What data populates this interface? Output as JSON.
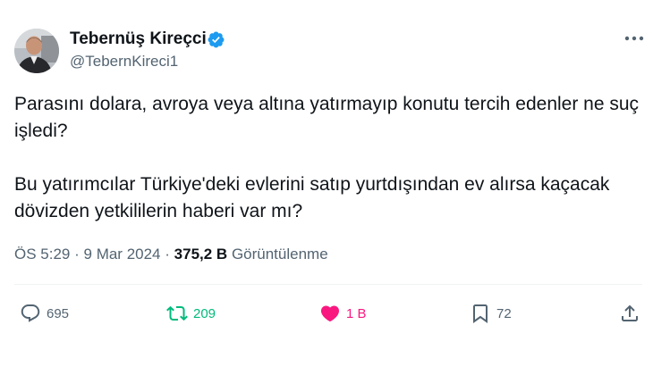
{
  "author": {
    "name": "Tebernüş Kireçci",
    "handle": "@TebernKireci1",
    "verified": true
  },
  "tweet": {
    "paragraphs": [
      "Parasını dolara, avroya veya altına yatırmayıp konutu tercih edenler ne suç işledi?",
      "Bu yatırımcılar Türkiye'deki evlerini satıp yurtdışından ev alırsa kaçacak dövizden yetkililerin haberi var mı?"
    ]
  },
  "meta": {
    "time": "ÖS 5:29",
    "separator": "·",
    "date": "9 Mar 2024",
    "views_count": "375,2 B",
    "views_label": "Görüntülenme"
  },
  "actions": {
    "replies": "695",
    "retweets": "209",
    "likes": "1 B",
    "bookmarks": "72"
  },
  "colors": {
    "verified": "#1d9bf0",
    "retweet": "#00ba7c",
    "like": "#f91880",
    "secondary_text": "#536471"
  }
}
